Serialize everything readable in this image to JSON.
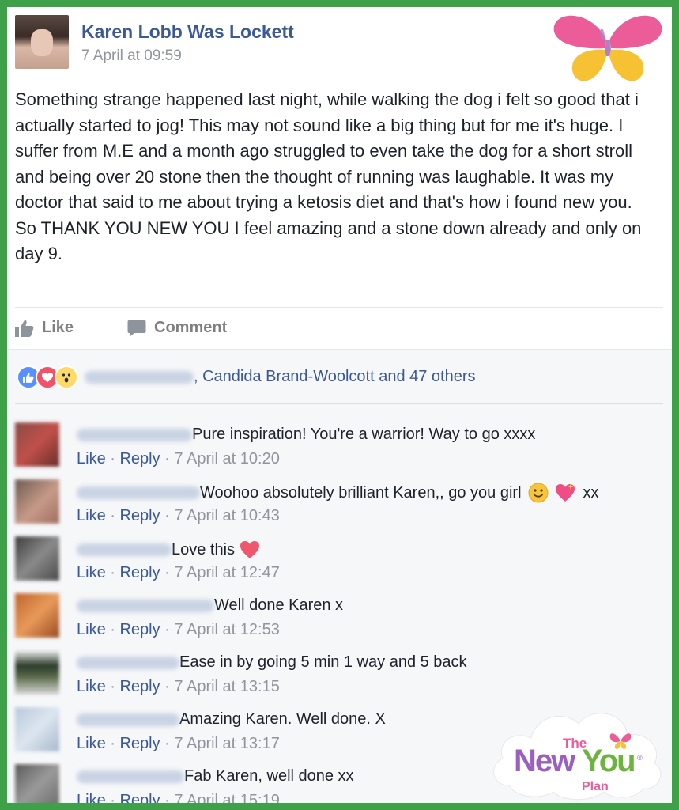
{
  "post": {
    "author": "Karen Lobb Was Lockett",
    "timestamp": "7 April at 09:59",
    "text": "Something strange happened last night, while walking the dog i felt so good that i actually started to jog! This may not sound like a big thing but for me it's huge. I suffer from M.E and a month ago struggled to even take the dog for a short stroll and being over 20 stone then the thought of running was laughable. It was my doctor that said to me about trying a ketosis diet and that's how i found new you.\nSo THANK YOU NEW YOU I feel amazing and a stone down already and only on day 9."
  },
  "actions": {
    "like_label": "Like",
    "comment_label": "Comment"
  },
  "reactions": {
    "icons": [
      "like-icon",
      "love-icon",
      "wow-icon"
    ],
    "text": ", Candida Brand-Woolcott and 47 others"
  },
  "comments": [
    {
      "text": "Pure inspiration! You're a warrior! Way to go xxxx",
      "like": "Like",
      "reply": "Reply",
      "time": "7 April at 10:20"
    },
    {
      "text": "Woohoo absolutely brilliant Karen,, go you girl",
      "suffix": "xx",
      "like": "Like",
      "reply": "Reply",
      "time": "7 April at 10:43"
    },
    {
      "text": "Love this",
      "like": "Like",
      "reply": "Reply",
      "time": "7 April at 12:47"
    },
    {
      "text": "Well done Karen x",
      "like": "Like",
      "reply": "Reply",
      "time": "7 April at 12:53"
    },
    {
      "text": "Ease in by going 5 min 1 way and 5 back",
      "like": "Like",
      "reply": "Reply",
      "time": "7 April at 13:15"
    },
    {
      "text": "Amazing Karen. Well done. X",
      "like": "Like",
      "reply": "Reply",
      "time": "7 April at 13:17"
    },
    {
      "text": "Fab Karen, well done xx",
      "like": "Like",
      "reply": "Reply",
      "time": "7 April at 15:19"
    }
  ],
  "separator": " · ",
  "logo": {
    "line1": "The",
    "line2a": "New",
    "line2b": "You",
    "line3": "Plan",
    "reg": "®"
  },
  "colors": {
    "frame": "#3fa04a",
    "link": "#3b5998",
    "meta": "#90949c"
  }
}
